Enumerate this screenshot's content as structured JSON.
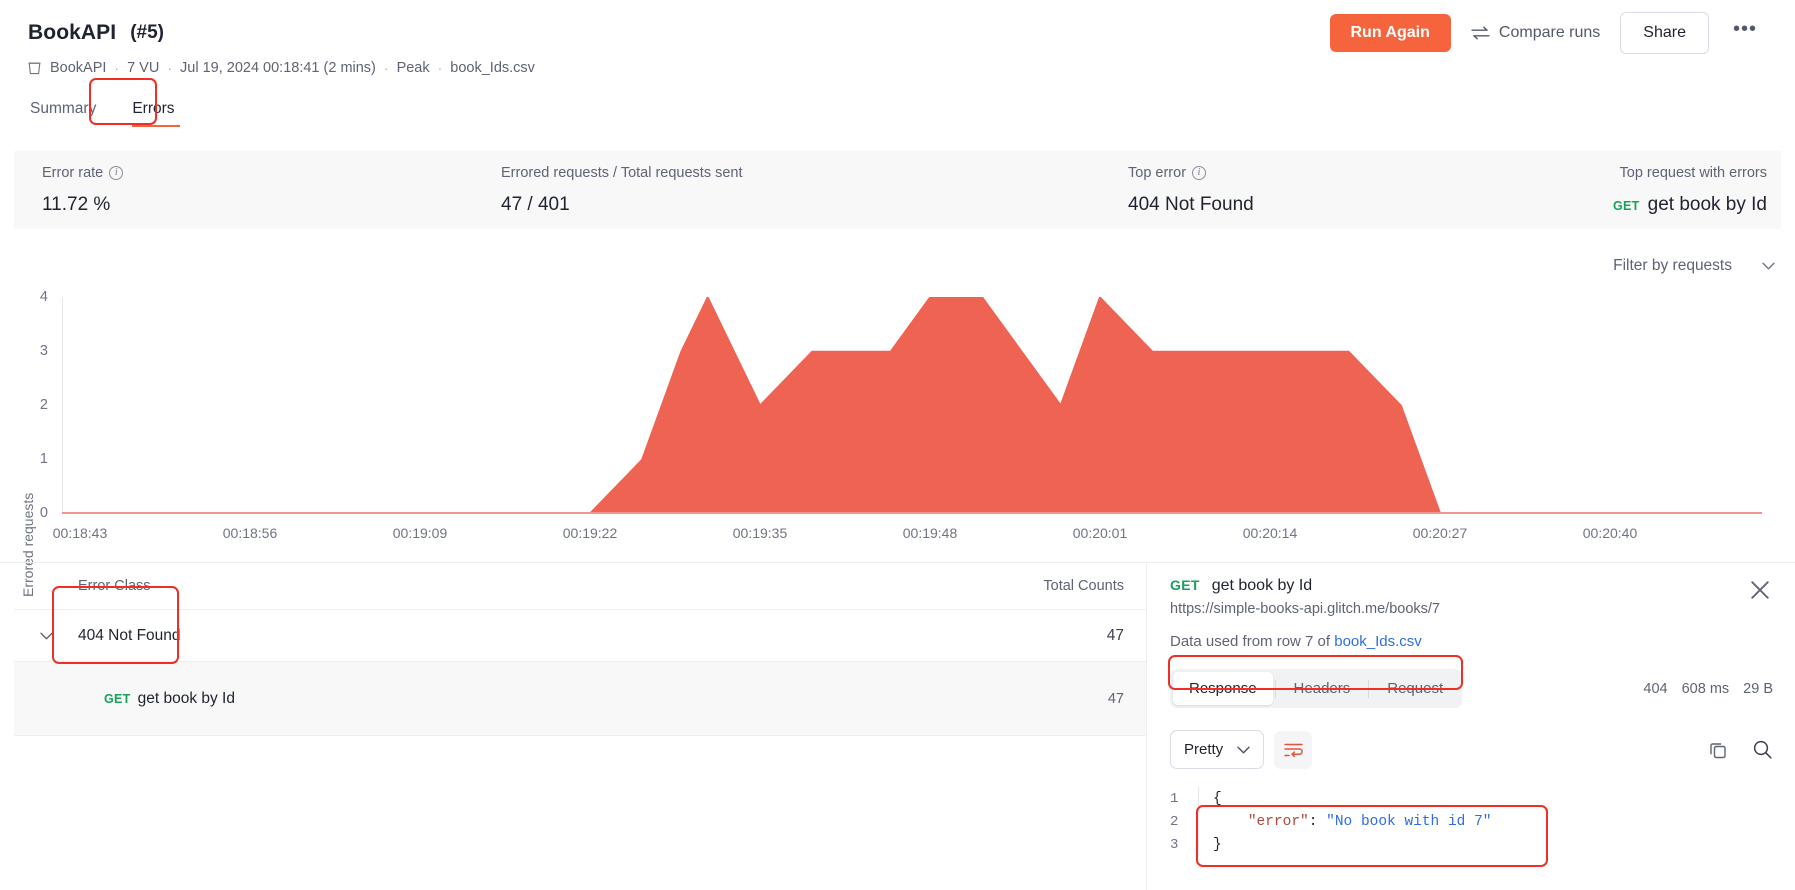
{
  "header": {
    "title": "BookAPI",
    "run_number": "(#5)",
    "run_again_label": "Run Again",
    "compare_label": "Compare runs",
    "share_label": "Share",
    "more_label": "•••",
    "accent_color": "#f5643c"
  },
  "meta": {
    "project": "BookAPI",
    "vu": "7 VU",
    "timestamp": "Jul 19, 2024 00:18:41 (2 mins)",
    "profile": "Peak",
    "data_file": "book_Ids.csv",
    "separator": "·"
  },
  "tabs": [
    {
      "label": "Summary",
      "active": false
    },
    {
      "label": "Errors",
      "active": true
    }
  ],
  "stats": [
    {
      "label": "Error rate",
      "has_info": true,
      "value": "11.72 %"
    },
    {
      "label": "Errored requests / Total requests sent",
      "has_info": false,
      "value": "47 / 401"
    },
    {
      "label": "Top error",
      "has_info": true,
      "value": "404 Not Found"
    },
    {
      "label": "Top request with errors",
      "has_info": false,
      "verb": "GET",
      "value": "get book by Id"
    }
  ],
  "chart_toolbar": {
    "filter_label": "Filter by requests"
  },
  "chart_data": {
    "type": "area",
    "title": "",
    "xlabel": "",
    "ylabel": "Errored requests",
    "ylim": [
      0,
      4
    ],
    "yticks": [
      0,
      1,
      2,
      3,
      4
    ],
    "grid": false,
    "legend": "none",
    "series_color": "#ee6352",
    "xticks": [
      "00:18:43",
      "00:18:56",
      "00:19:09",
      "00:19:22",
      "00:19:35",
      "00:19:48",
      "00:20:01",
      "00:20:14",
      "00:20:27",
      "00:20:40"
    ],
    "x": [
      "00:18:43",
      "00:18:50",
      "00:18:56",
      "00:19:03",
      "00:19:09",
      "00:19:16",
      "00:19:22",
      "00:19:26",
      "00:19:29",
      "00:19:31",
      "00:19:35",
      "00:19:39",
      "00:19:42",
      "00:19:45",
      "00:19:48",
      "00:19:52",
      "00:19:55",
      "00:19:58",
      "00:20:01",
      "00:20:05",
      "00:20:08",
      "00:20:14",
      "00:20:20",
      "00:20:24",
      "00:20:27",
      "00:20:34",
      "00:20:40",
      "00:20:47"
    ],
    "values": [
      0,
      0,
      0,
      0,
      0,
      0,
      0,
      1,
      3,
      4,
      2,
      3,
      3,
      3,
      4,
      4,
      3,
      2,
      4,
      3,
      3,
      3,
      3,
      2,
      0,
      0,
      0,
      0
    ]
  },
  "error_table": {
    "columns": [
      "Error Class",
      "Total Counts"
    ],
    "rows": [
      {
        "name": "404 Not Found",
        "count": "47",
        "expanded": true,
        "children": [
          {
            "verb": "GET",
            "name": "get book by Id",
            "count": "47"
          }
        ]
      }
    ]
  },
  "detail": {
    "verb": "GET",
    "name": "get book by Id",
    "url": "https://simple-books-api.glitch.me/books/7",
    "data_used_prefix": "Data used from row 7 of",
    "data_used_file": "book_Ids.csv",
    "tabs": [
      {
        "label": "Response",
        "active": true
      },
      {
        "label": "Headers",
        "active": false
      },
      {
        "label": "Request",
        "active": false
      }
    ],
    "response_meta": [
      "404",
      "608 ms",
      "29 B"
    ],
    "format_select": "Pretty",
    "code": [
      {
        "line": "1",
        "content": "{",
        "type": "punct"
      },
      {
        "line": "2",
        "indent": true,
        "key": "\"error\"",
        "colon": ": ",
        "value": "\"No book with id 7\""
      },
      {
        "line": "3",
        "content": "}",
        "type": "punct"
      }
    ]
  },
  "annotations": {
    "color": "#ef2f25",
    "boxes": [
      "errors-tab",
      "error-class-column",
      "data-used-row",
      "response-code-block"
    ]
  }
}
